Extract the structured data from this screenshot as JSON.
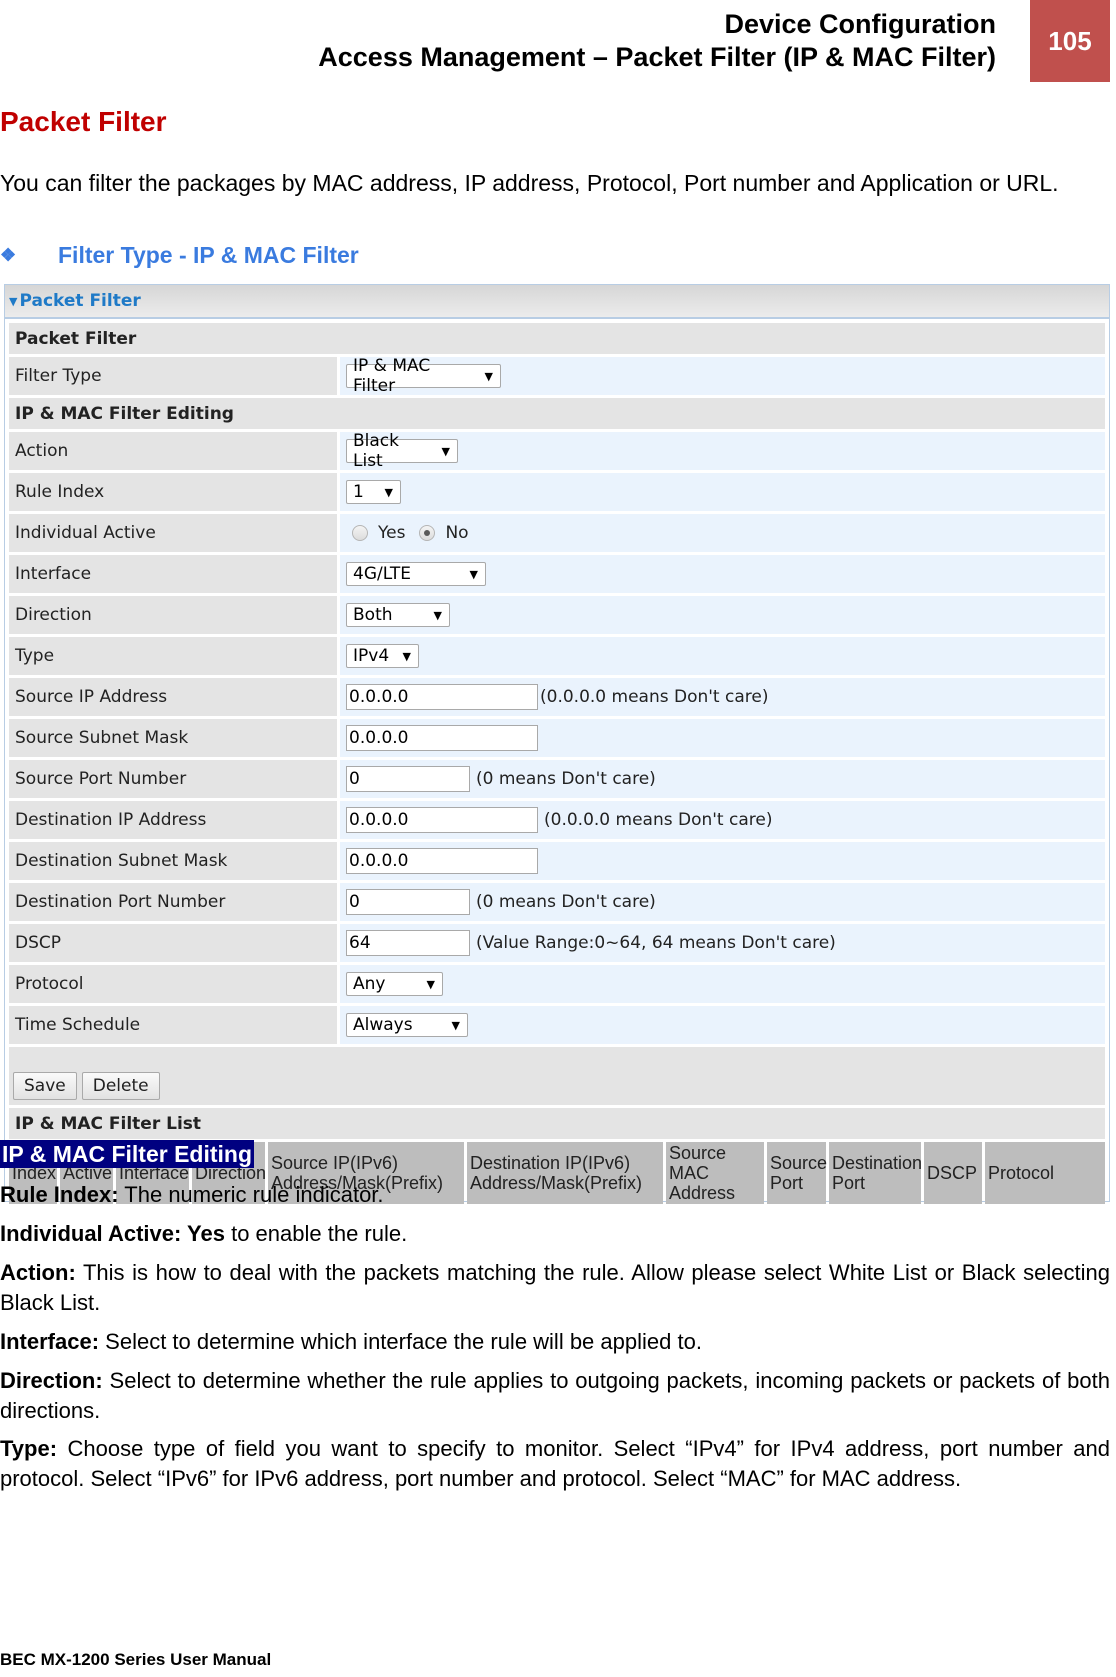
{
  "header": {
    "line1": "Device Configuration",
    "line2": "Access Management – Packet Filter (IP & MAC Filter)",
    "page_number": "105",
    "badge_color": "#c0504d"
  },
  "section_title": "Packet Filter",
  "intro": "You can filter the packages by MAC address, IP address, Protocol, Port number and Application or URL.",
  "subheading": {
    "icon": "diamond-bullet-icon",
    "text": "Filter Type - IP & MAC Filter"
  },
  "panel": {
    "title": "Packet Filter",
    "section1": "Packet Filter",
    "filter_type": {
      "label": "Filter Type",
      "value": "IP & MAC Filter"
    },
    "section2": "IP & MAC Filter Editing",
    "action": {
      "label": "Action",
      "value": "Black List"
    },
    "rule_index": {
      "label": "Rule Index",
      "value": "1"
    },
    "individual_active": {
      "label": "Individual Active",
      "options": [
        "Yes",
        "No"
      ],
      "selected": "No"
    },
    "interface": {
      "label": "Interface",
      "value": "4G/LTE"
    },
    "direction": {
      "label": "Direction",
      "value": "Both"
    },
    "type": {
      "label": "Type",
      "value": "IPv4"
    },
    "source_ip": {
      "label": "Source IP Address",
      "value": "0.0.0.0",
      "hint": "(0.0.0.0 means Don't care)"
    },
    "source_mask": {
      "label": "Source Subnet Mask",
      "value": "0.0.0.0"
    },
    "source_port": {
      "label": "Source Port Number",
      "value": "0",
      "hint": "(0 means Don't care)"
    },
    "dest_ip": {
      "label": "Destination IP Address",
      "value": "0.0.0.0",
      "hint": "(0.0.0.0 means Don't care)"
    },
    "dest_mask": {
      "label": "Destination Subnet Mask",
      "value": "0.0.0.0"
    },
    "dest_port": {
      "label": "Destination Port Number",
      "value": "0",
      "hint": "(0 means Don't care)"
    },
    "dscp": {
      "label": "DSCP",
      "value": "64",
      "hint": "(Value Range:0~64, 64 means Don't care)"
    },
    "protocol": {
      "label": "Protocol",
      "value": "Any"
    },
    "time_schedule": {
      "label": "Time Schedule",
      "value": "Always"
    },
    "buttons": {
      "save": "Save",
      "delete": "Delete"
    },
    "section3": "IP & MAC Filter List",
    "list_columns": [
      "Index",
      "Active",
      "Interface",
      "Direction",
      "Source IP(IPv6) Address/Mask(Prefix)",
      "Destination IP(IPv6) Address/Mask(Prefix)",
      "Source MAC Address",
      "Source Port",
      "Destination Port",
      "DSCP",
      "Protocol"
    ]
  },
  "description": {
    "heading": "IP & MAC Filter Editing",
    "items": [
      {
        "term": "Rule Index:",
        "text": " The numeric rule indicator."
      },
      {
        "term": "Individual Active: Yes",
        "text": " to enable the rule."
      },
      {
        "term": "Action:",
        "text": " This is how to deal with the packets matching the rule. Allow please select White List or Black selecting Black List."
      },
      {
        "term": "Interface:",
        "text": " Select to determine which interface the rule will be applied to."
      },
      {
        "term": "Direction:",
        "text": " Select to determine whether the rule applies to outgoing packets, incoming packets or packets of both directions."
      },
      {
        "term": "Type:",
        "text": " Choose type of field you want to specify to monitor. Select “IPv4” for IPv4 address, port number and protocol. Select “IPv6” for IPv6 address, port number and protocol. Select “MAC” for MAC address."
      }
    ]
  },
  "footer": "BEC MX-1200 Series User Manual"
}
